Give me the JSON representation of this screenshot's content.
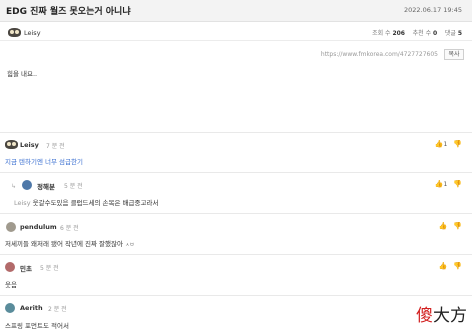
{
  "post": {
    "title": "EDG 진짜 월즈 못오는거 아니냐",
    "date": "2022.06.17 19:45",
    "author": "Leisy",
    "views_label": "조회 수",
    "views": "206",
    "likes_label": "추천 수",
    "likes": "0",
    "comments_label": "댓글",
    "comments": "5",
    "url": "https://www.fmkorea.com/4727727605",
    "copy_label": "복사",
    "body": "힘을 내요.."
  },
  "comments": [
    {
      "author": "Leisy",
      "time": "7 분 전",
      "text": "지금 텐하기엔 너무 섬급한기",
      "up": "1",
      "avatar_icon": "owl-avatar-icon"
    },
    {
      "author": "정해분",
      "time": "5 분 전",
      "quoted": "Leisy",
      "text": "웃갈수도있음 클럽드세의 손목은 배급중고라서",
      "up": "1",
      "avatar_icon": "character-avatar-icon"
    },
    {
      "author": "pendulum",
      "time": "6 분 전",
      "text": "저세끼들 왜저래 됐어 작년에 진짜 잘했잖아",
      "badge": "ㅅㅂ",
      "avatar_icon": "circle-avatar-icon"
    },
    {
      "author": "민초",
      "time": "5 분 전",
      "text": "웃음",
      "avatar_icon": "face-avatar-icon"
    },
    {
      "author": "Aerith",
      "time": "2 분 전",
      "text": "스프링 포먼트도 적어서",
      "avatar_icon": "flower-avatar-icon"
    }
  ],
  "watermark": {
    "char1": "傻",
    "char2": "大方"
  }
}
